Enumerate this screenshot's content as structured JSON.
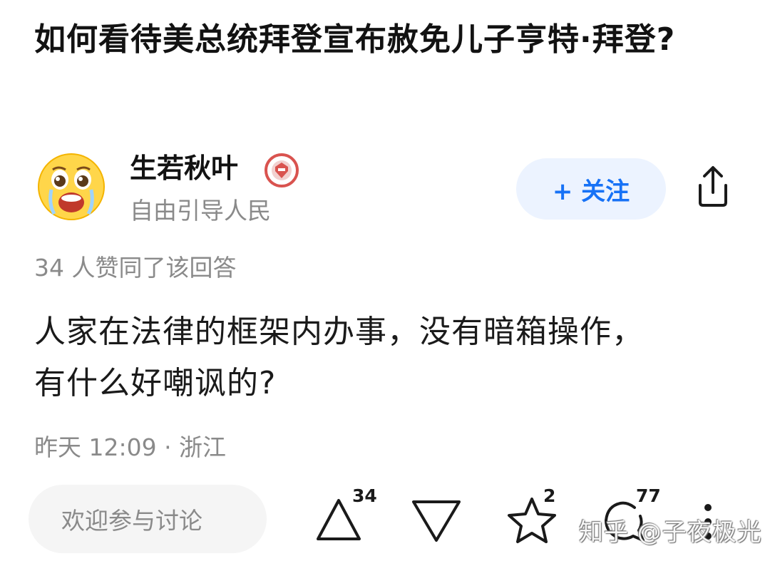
{
  "question": {
    "title": "如何看待美总统拜登宣布赦免儿子亨特·拜登?"
  },
  "author": {
    "avatar_icon": "crying-face-emoji-avatar",
    "name": "生若秋叶",
    "badge_icon": "red-circle-badge-icon",
    "bio": "自由引导人民"
  },
  "actions": {
    "follow_label": "+ 关注",
    "share_icon": "share-icon"
  },
  "answer": {
    "vote_summary": "34 人赞同了该回答",
    "lines": [
      "人家在法律的框架内办事，没有暗箱操作，",
      "有什么好嘲讽的?"
    ],
    "meta": "昨天 12:09 · 浙江"
  },
  "bottom_bar": {
    "comment_placeholder": "欢迎参与讨论",
    "upvote_count": "34",
    "favorite_count": "2",
    "comment_count": "77",
    "icons": [
      "upvote-triangle-icon",
      "downvote-triangle-icon",
      "star-icon",
      "comment-bubble-icon",
      "more-dots-icon"
    ]
  },
  "watermark": "知乎 @子夜极光",
  "colors": {
    "accent": "#1772f6",
    "follow_bg": "#ecf3ff",
    "secondary_text": "#8a8a8a",
    "comment_bg": "#f5f5f5"
  }
}
